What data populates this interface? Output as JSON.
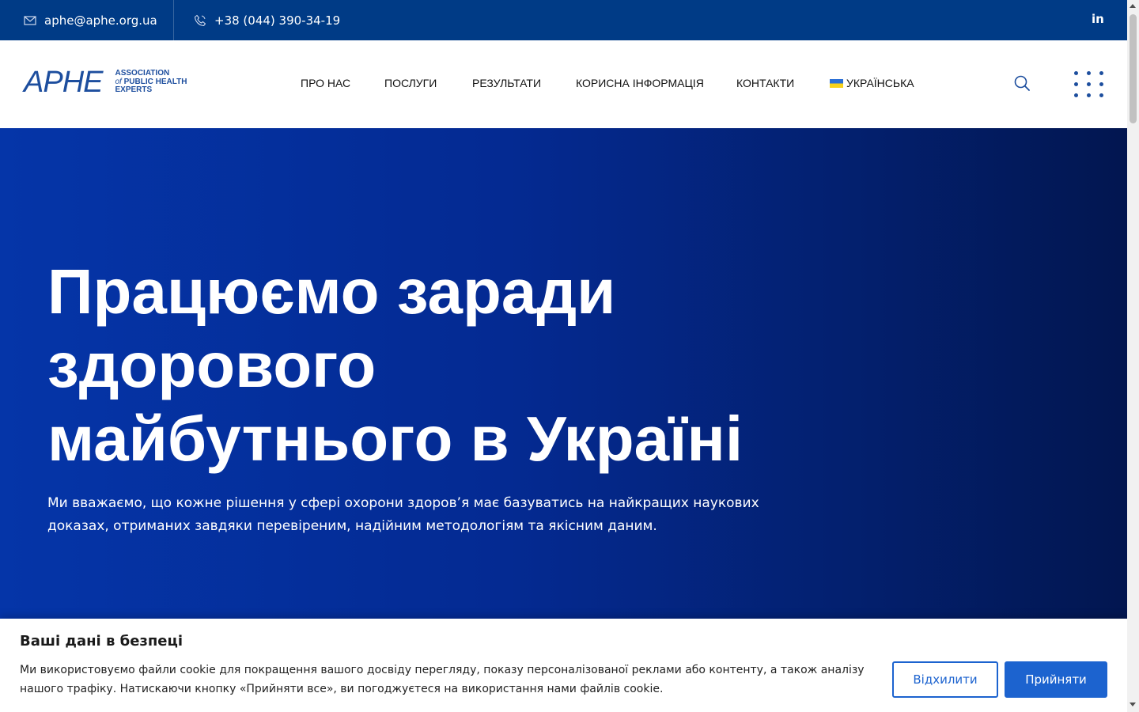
{
  "topbar": {
    "email": "aphe@aphe.org.ua",
    "phone": "+38 (044) 390-34-19",
    "social_icon": "linkedin-icon",
    "social_label": "in"
  },
  "header": {
    "logo": {
      "mark": "APHE",
      "line1": "ASSOCIATION",
      "line2_prefix": "of",
      "line2": " PUBLIC HEALTH",
      "line3": "EXPERTS"
    },
    "nav": [
      {
        "label": "ПРО НАС"
      },
      {
        "label": "ПОСЛУГИ"
      },
      {
        "label": "РЕЗУЛЬТАТИ"
      },
      {
        "label": "КОРИСНА ІНФОРМАЦІЯ"
      },
      {
        "label": "КОНТАКТИ"
      }
    ],
    "language": "УКРАЇНСЬКА",
    "icons": [
      "search-icon",
      "menu-grid-icon"
    ]
  },
  "hero": {
    "title_lines": [
      "Працюємо заради",
      "здорового",
      "майбутнього в Україні"
    ],
    "subtitle": "Ми вважаємо, що кожне рішення у сфері охорони здоров’я має базуватись на найкращих наукових доказах, отриманих завдяки перевіреним, надійним методологіям та якісним даним."
  },
  "cookie": {
    "title": "Ваші дані в безпеці",
    "text": "Ми використовуємо файли cookie для покращення вашого досвіду перегляду, показу персоналізованої реклами або контенту, а також аналізу нашого трафіку. Натискаючи кнопку «Прийняти все», ви погоджуєтеся на використання нами файлів cookie.",
    "reject_label": "Відхилити",
    "accept_label": "Прийняти"
  },
  "colors": {
    "topbar": "#003b86",
    "brand": "#1d4e9e",
    "accent": "#1c63cf",
    "hero_start": "#0535a8",
    "hero_end": "#021650"
  }
}
